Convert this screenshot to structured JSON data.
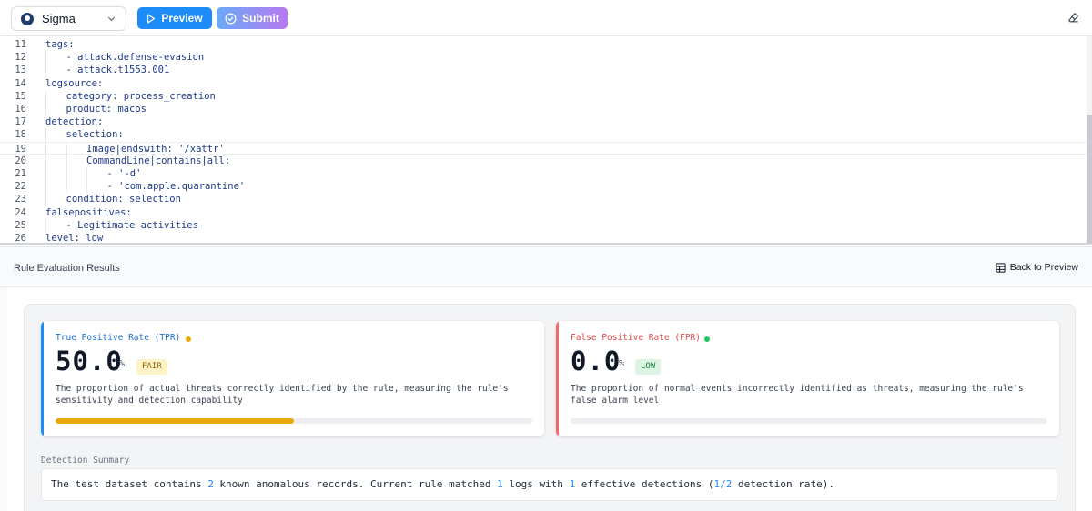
{
  "toolbar": {
    "language": "Sigma",
    "preview_label": "Preview",
    "submit_label": "Submit"
  },
  "editor": {
    "lines": [
      {
        "n": "11",
        "indent": 0,
        "text": "tags:"
      },
      {
        "n": "12",
        "indent": 1,
        "text": "- attack.defense-evasion"
      },
      {
        "n": "13",
        "indent": 1,
        "text": "- attack.t1553.001"
      },
      {
        "n": "14",
        "indent": 0,
        "text": "logsource:"
      },
      {
        "n": "15",
        "indent": 1,
        "text": "category: process_creation"
      },
      {
        "n": "16",
        "indent": 1,
        "text": "product: macos"
      },
      {
        "n": "17",
        "indent": 0,
        "text": "detection:"
      },
      {
        "n": "18",
        "indent": 1,
        "text": "selection:"
      },
      {
        "n": "19",
        "indent": 2,
        "text": "Image|endswith: '/xattr'",
        "active": true
      },
      {
        "n": "20",
        "indent": 2,
        "text": "CommandLine|contains|all:"
      },
      {
        "n": "21",
        "indent": 3,
        "text": "- '-d'"
      },
      {
        "n": "22",
        "indent": 3,
        "text": "- 'com.apple.quarantine'"
      },
      {
        "n": "23",
        "indent": 1,
        "text": "condition: selection"
      },
      {
        "n": "24",
        "indent": 0,
        "text": "falsepositives:"
      },
      {
        "n": "25",
        "indent": 1,
        "text": "- Legitimate activities"
      },
      {
        "n": "26",
        "indent": 0,
        "text": "level: low"
      }
    ]
  },
  "results": {
    "title": "Rule Evaluation Results",
    "back_label": "Back to Preview",
    "tpr": {
      "title": "True Positive Rate (TPR)",
      "value": "50.0",
      "unit": "%",
      "badge": "FAIR",
      "description": "The proportion of actual threats correctly identified by the rule, measuring the rule's sensitivity and detection capability",
      "progress": 0.5,
      "dot_color": "#e9a80b"
    },
    "fpr": {
      "title": "False Positive Rate (FPR)",
      "value": "0.0",
      "unit": "%",
      "badge": "LOW",
      "description": "The proportion of normal events incorrectly identified as threats, measuring the rule's false alarm level",
      "progress": 0.0,
      "dot_color": "#22c55e"
    },
    "summary_label": "Detection Summary",
    "summary": {
      "p1": "The test dataset contains ",
      "known": "2",
      "p2": " known anomalous records. Current rule matched ",
      "matched": "1",
      "p3": " logs with ",
      "effective": "1",
      "p4": " effective detections (",
      "rate": "1/2",
      "p5": " detection rate)."
    }
  }
}
